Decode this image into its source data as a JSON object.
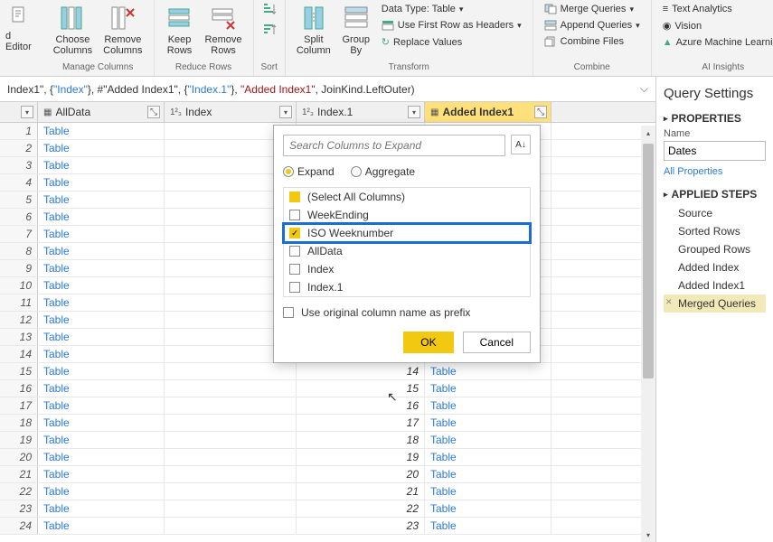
{
  "ribbon": {
    "editor_line2": "d Editor",
    "choose_cols": "Choose\nColumns",
    "remove_cols": "Remove\nColumns",
    "manage_cols": "Manage Columns",
    "keep_rows": "Keep\nRows",
    "remove_rows": "Remove\nRows",
    "reduce_rows": "Reduce Rows",
    "sort": "Sort",
    "split_col": "Split\nColumn",
    "group_by": "Group\nBy",
    "datatype": "Data Type: Table",
    "first_row": "Use First Row as Headers",
    "replace": "Replace Values",
    "transform": "Transform",
    "merge_q": "Merge Queries",
    "append_q": "Append Queries",
    "combine_files": "Combine Files",
    "combine": "Combine",
    "text_analytics": "Text Analytics",
    "vision": "Vision",
    "azure_ml": "Azure Machine Learning",
    "ai": "AI Insights"
  },
  "formula": {
    "p1": "Index1\", {",
    "f1": "\"Index\"",
    "p2": "}, #\"Added Index1\", {",
    "f2": "\"Index.1\"",
    "p3": "}, ",
    "s1": "\"Added Index1\"",
    "p4": ", JoinKind.LeftOuter)"
  },
  "columns": {
    "c1": "AllData",
    "c2": "Index",
    "c3": "Index.1",
    "c4": "Added Index1"
  },
  "table_link": "Table",
  "rows": [
    {
      "n": "1",
      "i": "",
      "i1": "",
      "a": ""
    },
    {
      "n": "2",
      "i": "",
      "i1": "",
      "a": ""
    },
    {
      "n": "3",
      "i": "",
      "i1": "",
      "a": ""
    },
    {
      "n": "4",
      "i": "",
      "i1": "",
      "a": ""
    },
    {
      "n": "5",
      "i": "",
      "i1": "",
      "a": ""
    },
    {
      "n": "6",
      "i": "",
      "i1": "",
      "a": ""
    },
    {
      "n": "7",
      "i": "",
      "i1": "",
      "a": ""
    },
    {
      "n": "8",
      "i": "",
      "i1": "",
      "a": ""
    },
    {
      "n": "9",
      "i": "",
      "i1": "",
      "a": ""
    },
    {
      "n": "10",
      "i": "",
      "i1": "",
      "a": ""
    },
    {
      "n": "11",
      "i": "",
      "i1": "",
      "a": ""
    },
    {
      "n": "12",
      "i": "",
      "i1": "",
      "a": ""
    },
    {
      "n": "13",
      "i": "",
      "i1": "",
      "a": ""
    },
    {
      "n": "14",
      "i": "",
      "i1": "14",
      "a": "Table"
    },
    {
      "n": "15",
      "i": "",
      "i1": "14",
      "a": "Table"
    },
    {
      "n": "16",
      "i": "",
      "i1": "15",
      "a": "Table"
    },
    {
      "n": "17",
      "i": "",
      "i1": "16",
      "a": "Table"
    },
    {
      "n": "18",
      "i": "",
      "i1": "17",
      "a": "Table"
    },
    {
      "n": "19",
      "i": "",
      "i1": "18",
      "a": "Table"
    },
    {
      "n": "20",
      "i": "",
      "i1": "19",
      "a": "Table"
    },
    {
      "n": "21",
      "i": "",
      "i1": "20",
      "a": "Table"
    },
    {
      "n": "22",
      "i": "",
      "i1": "21",
      "a": "Table"
    },
    {
      "n": "23",
      "i": "",
      "i1": "22",
      "a": "Table"
    },
    {
      "n": "24",
      "i": "",
      "i1": "23",
      "a": "Table"
    }
  ],
  "popup": {
    "search_placeholder": "Search Columns to Expand",
    "expand": "Expand",
    "aggregate": "Aggregate",
    "select_all": "(Select All Columns)",
    "items": [
      "WeekEnding",
      "ISO Weeknumber",
      "AllData",
      "Index",
      "Index.1"
    ],
    "prefix": "Use original column name as prefix",
    "ok": "OK",
    "cancel": "Cancel"
  },
  "rp": {
    "title": "Query Settings",
    "properties": "PROPERTIES",
    "name": "Name",
    "name_val": "Dates",
    "all_props": "All Properties",
    "applied": "APPLIED STEPS",
    "steps": [
      "Source",
      "Sorted Rows",
      "Grouped Rows",
      "Added Index",
      "Added Index1",
      "Merged Queries"
    ]
  }
}
